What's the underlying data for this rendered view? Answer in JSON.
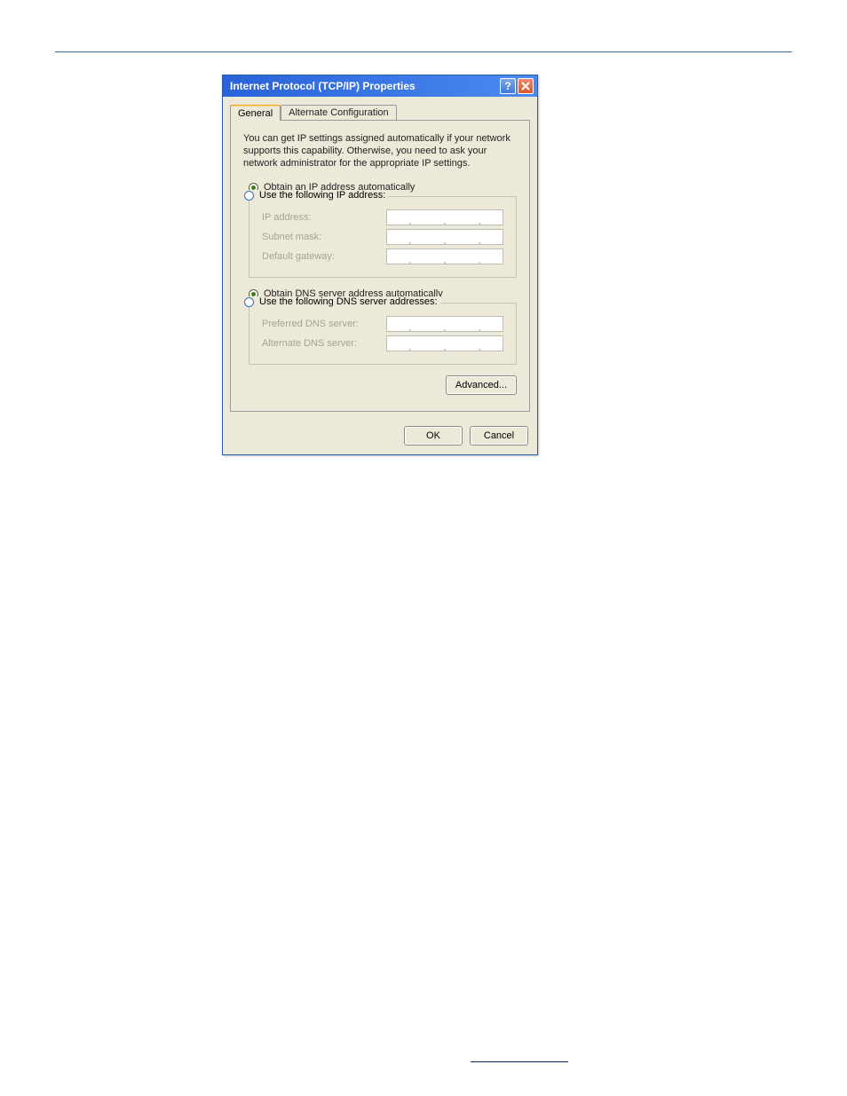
{
  "window": {
    "title": "Internet Protocol (TCP/IP) Properties"
  },
  "tabs": {
    "active": "General",
    "inactive": "Alternate Configuration"
  },
  "description": "You can get IP settings assigned automatically if your network supports this capability. Otherwise, you need to ask your network administrator for the appropriate IP settings.",
  "ip": {
    "obtain_auto": "Obtain an IP address automatically",
    "use_following": "Use the following IP address:",
    "address_label": "IP address:",
    "subnet_label": "Subnet mask:",
    "gateway_label": "Default gateway:"
  },
  "dns": {
    "obtain_auto": "Obtain DNS server address automatically",
    "use_following": "Use the following DNS server addresses:",
    "preferred_label": "Preferred DNS server:",
    "alternate_label": "Alternate DNS server:"
  },
  "buttons": {
    "advanced": "Advanced...",
    "ok": "OK",
    "cancel": "Cancel"
  }
}
